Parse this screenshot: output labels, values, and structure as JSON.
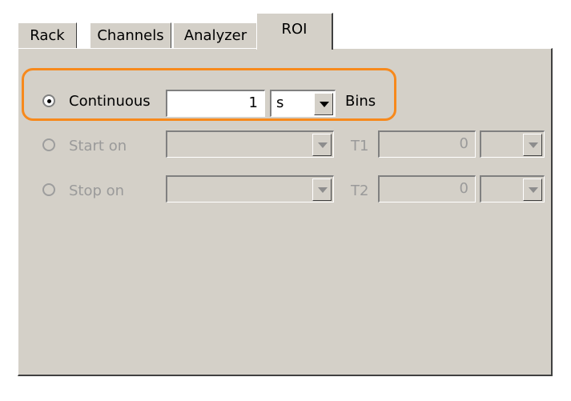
{
  "tabs": [
    {
      "label": "Rack"
    },
    {
      "label": "Channels"
    },
    {
      "label": "Analyzer"
    },
    {
      "label": "ROI"
    }
  ],
  "roi": {
    "continuous_label": "Continuous",
    "continuous_value": "1",
    "continuous_unit": "s",
    "bins_label": "Bins",
    "start_label": "Start on",
    "stop_label": "Stop on",
    "t1_label": "T1",
    "t1_value": "0",
    "t2_label": "T2",
    "t2_value": "0"
  },
  "colors": {
    "highlight": "#f7891c",
    "panel": "#d4d0c8"
  }
}
